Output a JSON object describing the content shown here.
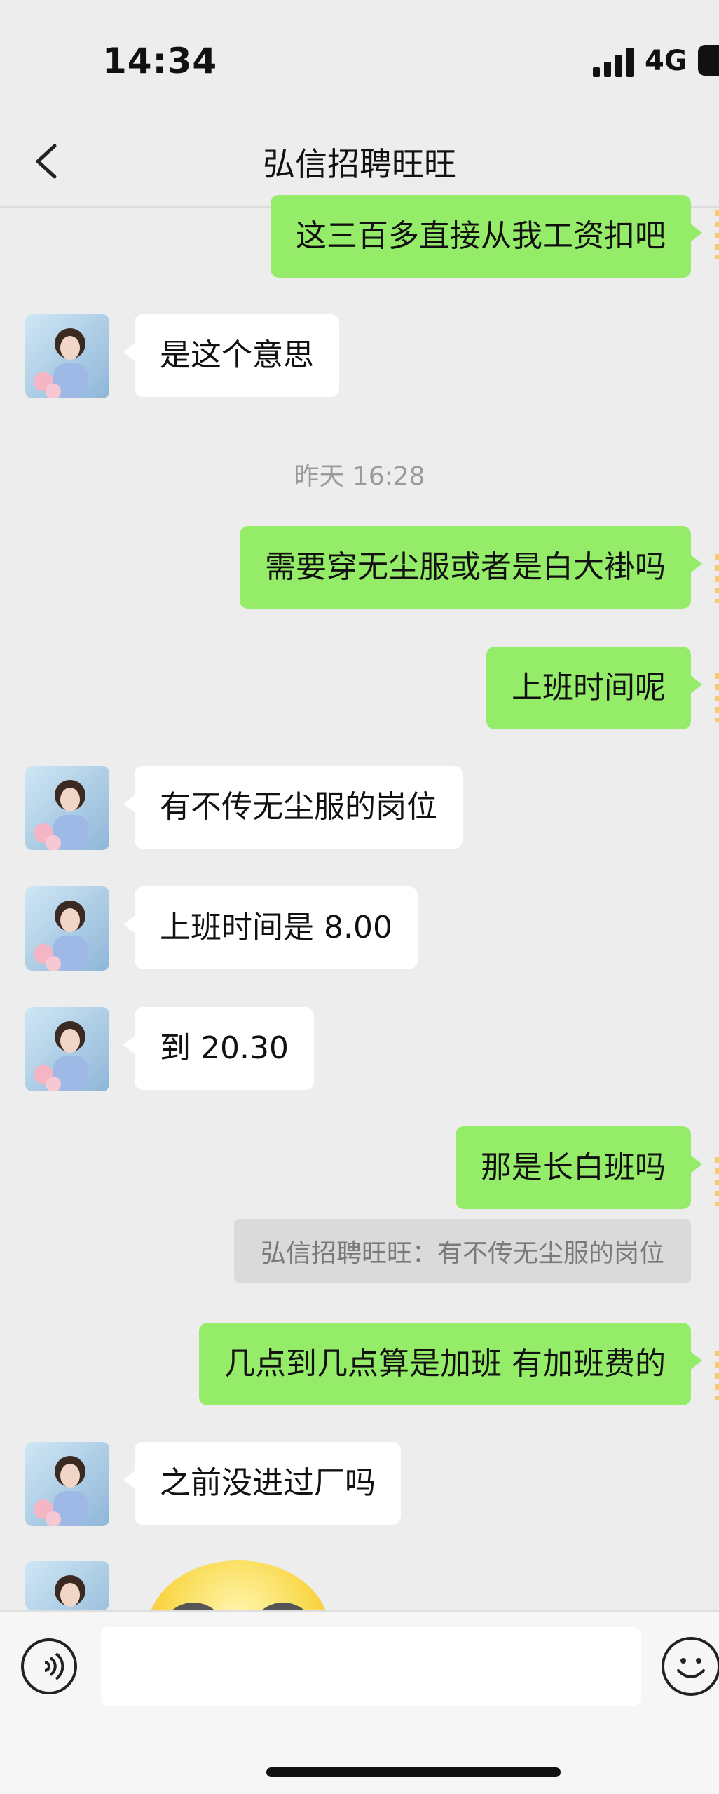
{
  "status_bar": {
    "time": "14:34",
    "network": "4G"
  },
  "nav": {
    "title": "弘信招聘旺旺",
    "back_icon": "chevron-left-icon"
  },
  "messages": [
    {
      "side": "me",
      "text": "这三百多直接从我工资扣吧"
    },
    {
      "side": "them",
      "text": "是这个意思"
    },
    {
      "type": "timestamp",
      "text": "昨天 16:28"
    },
    {
      "side": "me",
      "text": "需要穿无尘服或者是白大褂吗"
    },
    {
      "side": "me",
      "text": "上班时间呢"
    },
    {
      "side": "them",
      "text": "有不传无尘服的岗位"
    },
    {
      "side": "them",
      "text": "上班时间是 8.00"
    },
    {
      "side": "them",
      "text": "到 20.30"
    },
    {
      "side": "me",
      "text": "那是长白班吗"
    },
    {
      "type": "quote",
      "text": "弘信招聘旺旺：有不传无尘服的岗位"
    },
    {
      "side": "me",
      "text": "几点到几点算是加班 有加班费的"
    },
    {
      "side": "them",
      "text": "之前没进过厂吗"
    },
    {
      "side": "them",
      "type": "sticker",
      "text": ""
    }
  ],
  "input_bar": {
    "voice_icon": "voice-icon",
    "emoji_icon": "emoji-icon",
    "input_value": ""
  },
  "colors": {
    "my_bubble": "#95ec69",
    "their_bubble": "#ffffff",
    "background": "#ededed"
  }
}
